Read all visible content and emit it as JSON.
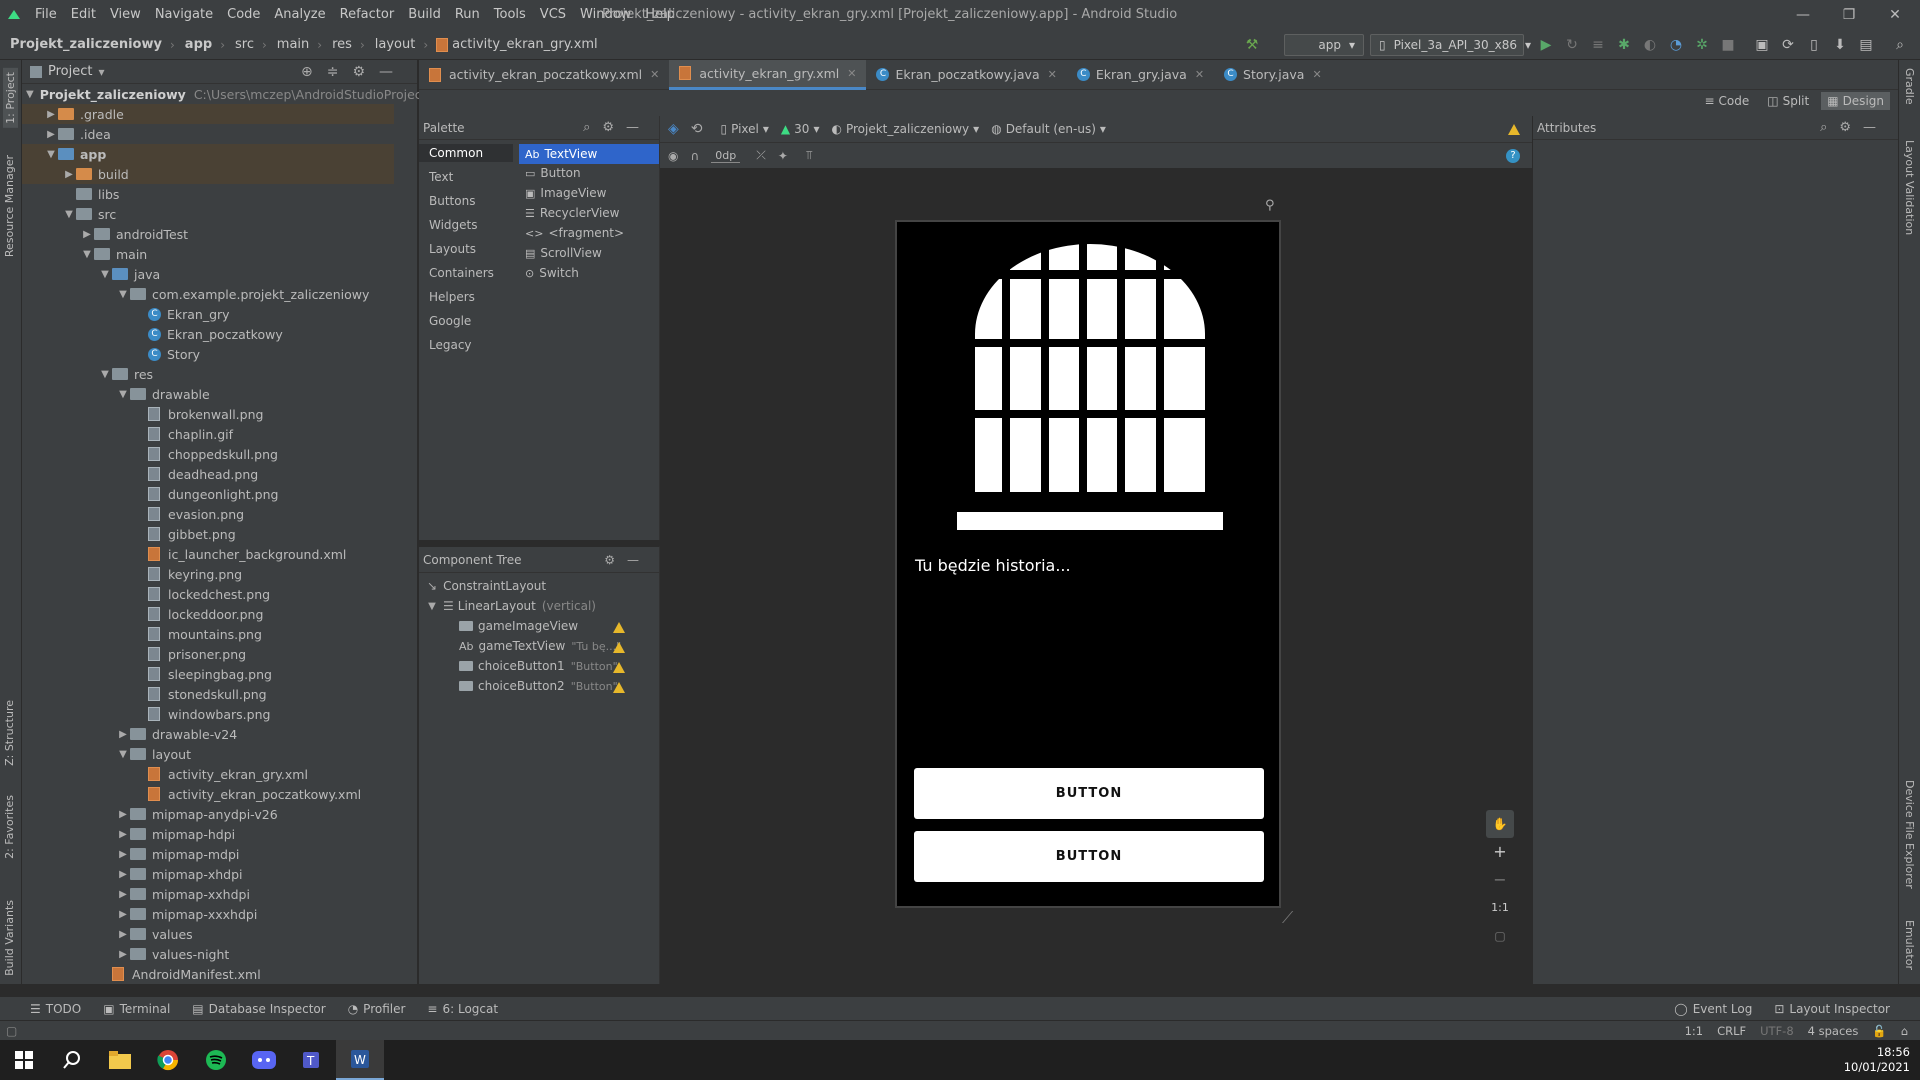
{
  "menubar": {
    "items": [
      "File",
      "Edit",
      "View",
      "Navigate",
      "Code",
      "Analyze",
      "Refactor",
      "Build",
      "Run",
      "Tools",
      "VCS",
      "Window",
      "Help"
    ],
    "title": "Projekt_zaliczeniowy - activity_ekran_gry.xml [Projekt_zaliczeniowy.app] - Android Studio"
  },
  "navbar": {
    "crumbs": [
      "Projekt_zaliczeniowy",
      "app",
      "src",
      "main",
      "res",
      "layout",
      "activity_ekran_gry.xml"
    ],
    "config": "app",
    "device": "Pixel_3a_API_30_x86"
  },
  "project": {
    "header": "Project",
    "root_name": "Projekt_zaliczeniowy",
    "root_path": "C:\\Users\\mczep\\AndroidStudioProjects\\Pr",
    "tree": [
      ".gradle",
      ".idea",
      "app",
      "build",
      "libs",
      "src",
      "androidTest",
      "main",
      "java",
      "com.example.projekt_zaliczeniowy",
      "Ekran_gry",
      "Ekran_poczatkowy",
      "Story",
      "res",
      "drawable",
      "brokenwall.png",
      "chaplin.gif",
      "choppedskull.png",
      "deadhead.png",
      "dungeonlight.png",
      "evasion.png",
      "gibbet.png",
      "ic_launcher_background.xml",
      "keyring.png",
      "lockedchest.png",
      "lockeddoor.png",
      "mountains.png",
      "prisoner.png",
      "sleepingbag.png",
      "stonedskull.png",
      "windowbars.png",
      "drawable-v24",
      "layout",
      "activity_ekran_gry.xml",
      "activity_ekran_poczatkowy.xml",
      "mipmap-anydpi-v26",
      "mipmap-hdpi",
      "mipmap-mdpi",
      "mipmap-xhdpi",
      "mipmap-xxhdpi",
      "mipmap-xxxhdpi",
      "values",
      "values-night",
      "AndroidManifest.xml"
    ]
  },
  "tabs": [
    "activity_ekran_poczatkowy.xml",
    "activity_ekran_gry.xml",
    "Ekran_poczatkowy.java",
    "Ekran_gry.java",
    "Story.java"
  ],
  "viewmodes": [
    "Code",
    "Split",
    "Design"
  ],
  "palette": {
    "title": "Palette",
    "categories": [
      "Common",
      "Text",
      "Buttons",
      "Widgets",
      "Layouts",
      "Containers",
      "Helpers",
      "Google",
      "Legacy"
    ],
    "items": [
      "TextView",
      "Button",
      "ImageView",
      "RecyclerView",
      "<fragment>",
      "ScrollView",
      "Switch"
    ]
  },
  "designbar": {
    "device": "Pixel",
    "api": "30",
    "theme": "Projekt_zaliczeniowy",
    "locale": "Default (en-us)",
    "margin": "0dp"
  },
  "component_tree": {
    "title": "Component Tree",
    "nodes": [
      {
        "name": "ConstraintLayout",
        "extra": ""
      },
      {
        "name": "LinearLayout",
        "extra": "(vertical)"
      },
      {
        "name": "gameImageView",
        "extra": ""
      },
      {
        "name": "gameTextView",
        "extra": "\"Tu bę...\""
      },
      {
        "name": "choiceButton1",
        "extra": "\"Button\""
      },
      {
        "name": "choiceButton2",
        "extra": "\"Button\""
      }
    ]
  },
  "phone": {
    "story_text": "Tu będzie  historia...",
    "button1": "BUTTON",
    "button2": "BUTTON"
  },
  "attributes": {
    "title": "Attributes"
  },
  "zoom": {
    "label": "1:1"
  },
  "bottom": {
    "tools": [
      "TODO",
      "Terminal",
      "Database Inspector",
      "Profiler",
      "6: Logcat"
    ],
    "right": [
      "Event Log",
      "Layout Inspector"
    ]
  },
  "status": {
    "position": "1:1",
    "eol": "CRLF",
    "encoding": "UTF-8",
    "indent": "4 spaces"
  },
  "left_tabs": [
    "1: Project",
    "Resource Manager",
    "Z: Structure",
    "2: Favorites",
    "Build Variants"
  ],
  "right_tabs": [
    "Gradle",
    "Layout Validation",
    "Device File Explorer",
    "Emulator"
  ],
  "clock": {
    "time": "18:56",
    "date": "10/01/2021"
  }
}
